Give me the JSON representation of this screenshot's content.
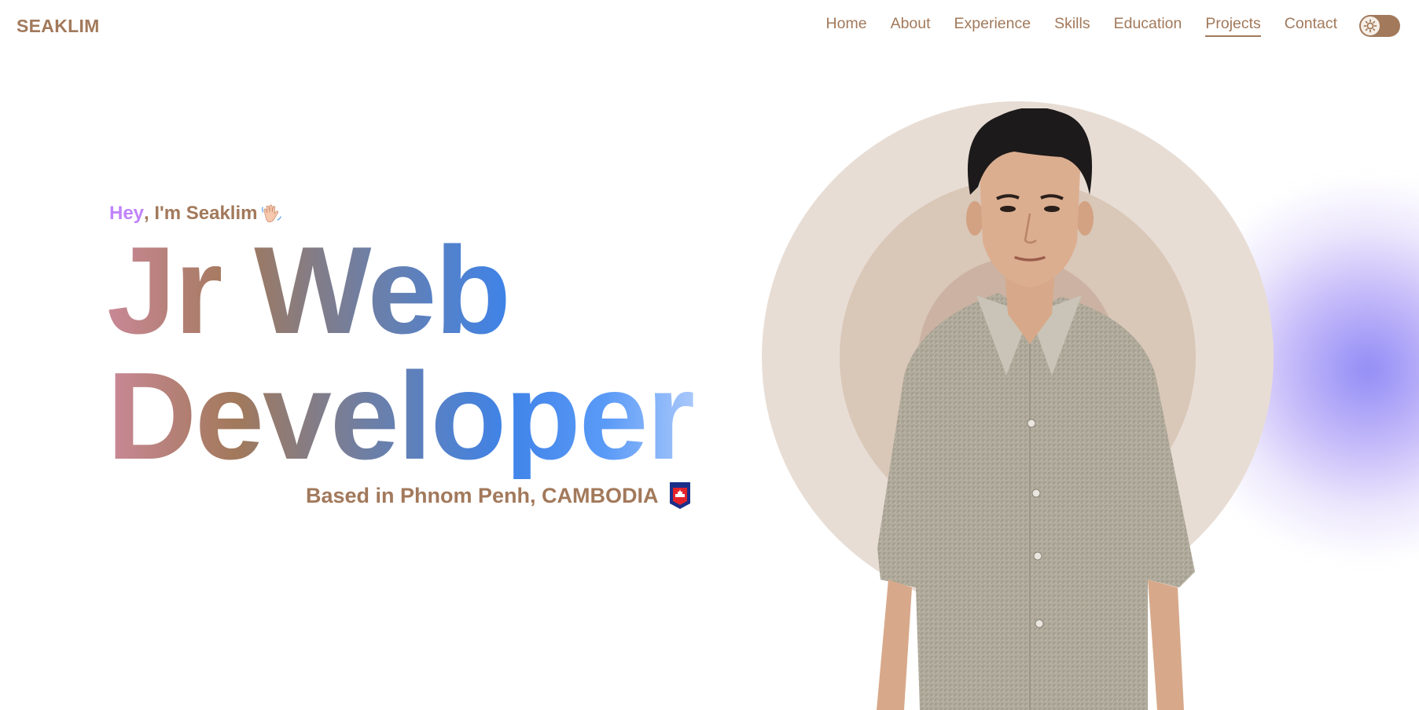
{
  "header": {
    "brand": "SEAKLIM",
    "nav": [
      {
        "label": "Home",
        "active": false
      },
      {
        "label": "About",
        "active": false
      },
      {
        "label": "Experience",
        "active": false
      },
      {
        "label": "Skills",
        "active": false
      },
      {
        "label": "Education",
        "active": false
      },
      {
        "label": "Projects",
        "active": true
      },
      {
        "label": "Contact",
        "active": false
      }
    ],
    "theme_toggle_icon": "sun-icon"
  },
  "hero": {
    "greeting_hey": "Hey",
    "greeting_rest": ", I'm Seaklim",
    "greeting_icon": "waving-hand-icon",
    "title_line1": "Jr Web",
    "title_line2": "Developer",
    "location": "Based in Phnom Penh, CAMBODIA",
    "location_icon": "cambodia-flag-icon",
    "portrait_icon": "portrait-photo"
  },
  "colors": {
    "brand": "#a2795b",
    "hey": "#c084fc",
    "ring_outer": "#e8ddd4",
    "ring_mid": "#d9c7b8",
    "ring_inner": "#cbb2a2",
    "blob": "#7e78f4"
  }
}
